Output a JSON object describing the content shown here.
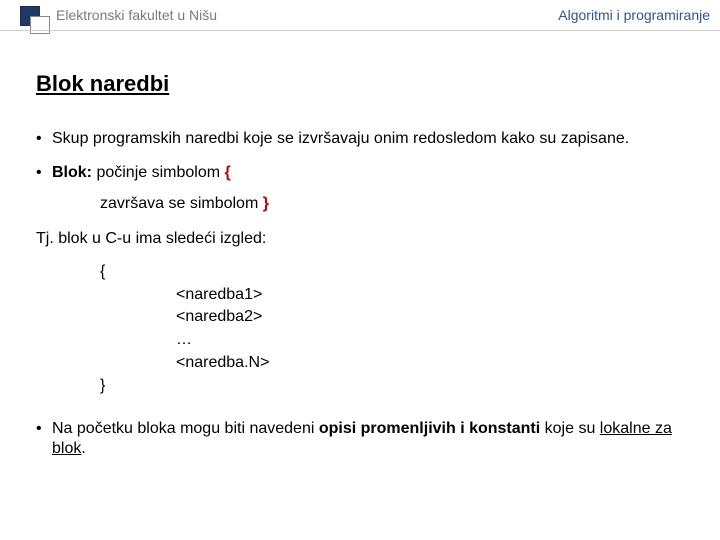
{
  "header": {
    "left": "Elektronski fakultet u Nišu",
    "right": "Algoritmi i programiranje"
  },
  "title": "Blok naredbi",
  "bullet1": "Skup programskih naredbi koje se izvršavaju onim redosledom kako su zapisane.",
  "bullet2": {
    "label": "Blok:",
    "line1_pre": " počinje simbolom ",
    "brace_open": "{",
    "line2_pre": "završava se simbolom ",
    "brace_close": "}"
  },
  "para_intro": "Tj. blok u C-u ima sledeći izgled:",
  "code": {
    "open": "{",
    "n1": "<naredba1>",
    "n2": "<naredba2>",
    "dots": "…",
    "nN": "<naredba.N>",
    "close": "}"
  },
  "bullet3": {
    "pre": "Na početku bloka mogu biti navedeni ",
    "bold": "opisi promenljivih i konstanti",
    "mid": " koje su ",
    "tail": "lokalne za blok",
    "end": "."
  }
}
